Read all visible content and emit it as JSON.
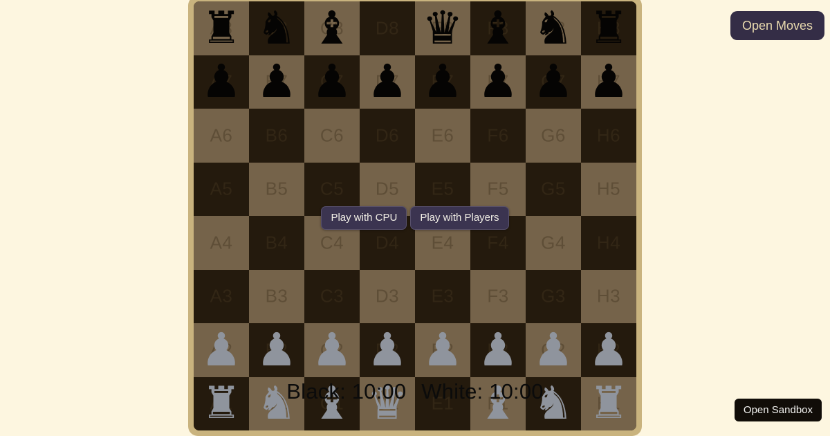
{
  "page": {
    "background_color": "#fdf6e0"
  },
  "board": {
    "border_color": "#c9b37e",
    "light_square_color": "#75634a",
    "dark_square_color": "#241a0d",
    "files": [
      "A",
      "B",
      "C",
      "D",
      "E",
      "F",
      "G",
      "H"
    ],
    "ranks": [
      "8",
      "7",
      "6",
      "5",
      "4",
      "3",
      "2",
      "1"
    ],
    "squares": [
      [
        {
          "label": "A8",
          "shade": "light",
          "piece": "rook",
          "color": "black",
          "glyph": "♜"
        },
        {
          "label": "B8",
          "shade": "dark",
          "piece": "knight",
          "color": "black",
          "glyph": "♞"
        },
        {
          "label": "C8",
          "shade": "light",
          "piece": "bishop",
          "color": "black",
          "glyph": "♝"
        },
        {
          "label": "D8",
          "shade": "dark",
          "piece": null,
          "color": null,
          "glyph": ""
        },
        {
          "label": "E8",
          "shade": "light",
          "piece": "queen",
          "color": "black",
          "glyph": "♛"
        },
        {
          "label": "F8",
          "shade": "dark",
          "piece": "bishop",
          "color": "black",
          "glyph": "♝"
        },
        {
          "label": "G8",
          "shade": "light",
          "piece": "knight",
          "color": "black",
          "glyph": "♞"
        },
        {
          "label": "H8",
          "shade": "dark",
          "piece": "rook",
          "color": "black",
          "glyph": "♜"
        }
      ],
      [
        {
          "label": "A7",
          "shade": "dark",
          "piece": "pawn",
          "color": "black",
          "glyph": "♟"
        },
        {
          "label": "B7",
          "shade": "light",
          "piece": "pawn",
          "color": "black",
          "glyph": "♟"
        },
        {
          "label": "C7",
          "shade": "dark",
          "piece": "pawn",
          "color": "black",
          "glyph": "♟"
        },
        {
          "label": "D7",
          "shade": "light",
          "piece": "pawn",
          "color": "black",
          "glyph": "♟"
        },
        {
          "label": "E7",
          "shade": "dark",
          "piece": "pawn",
          "color": "black",
          "glyph": "♟"
        },
        {
          "label": "F7",
          "shade": "light",
          "piece": "pawn",
          "color": "black",
          "glyph": "♟"
        },
        {
          "label": "G7",
          "shade": "dark",
          "piece": "pawn",
          "color": "black",
          "glyph": "♟"
        },
        {
          "label": "H7",
          "shade": "light",
          "piece": "pawn",
          "color": "black",
          "glyph": "♟"
        }
      ],
      [
        {
          "label": "A6",
          "shade": "light",
          "piece": null,
          "color": null,
          "glyph": ""
        },
        {
          "label": "B6",
          "shade": "dark",
          "piece": null,
          "color": null,
          "glyph": ""
        },
        {
          "label": "C6",
          "shade": "light",
          "piece": null,
          "color": null,
          "glyph": ""
        },
        {
          "label": "D6",
          "shade": "dark",
          "piece": null,
          "color": null,
          "glyph": ""
        },
        {
          "label": "E6",
          "shade": "light",
          "piece": null,
          "color": null,
          "glyph": ""
        },
        {
          "label": "F6",
          "shade": "dark",
          "piece": null,
          "color": null,
          "glyph": ""
        },
        {
          "label": "G6",
          "shade": "light",
          "piece": null,
          "color": null,
          "glyph": ""
        },
        {
          "label": "H6",
          "shade": "dark",
          "piece": null,
          "color": null,
          "glyph": ""
        }
      ],
      [
        {
          "label": "A5",
          "shade": "dark",
          "piece": null,
          "color": null,
          "glyph": ""
        },
        {
          "label": "B5",
          "shade": "light",
          "piece": null,
          "color": null,
          "glyph": ""
        },
        {
          "label": "C5",
          "shade": "dark",
          "piece": null,
          "color": null,
          "glyph": ""
        },
        {
          "label": "D5",
          "shade": "light",
          "piece": null,
          "color": null,
          "glyph": ""
        },
        {
          "label": "E5",
          "shade": "dark",
          "piece": null,
          "color": null,
          "glyph": ""
        },
        {
          "label": "F5",
          "shade": "light",
          "piece": null,
          "color": null,
          "glyph": ""
        },
        {
          "label": "G5",
          "shade": "dark",
          "piece": null,
          "color": null,
          "glyph": ""
        },
        {
          "label": "H5",
          "shade": "light",
          "piece": null,
          "color": null,
          "glyph": ""
        }
      ],
      [
        {
          "label": "A4",
          "shade": "light",
          "piece": null,
          "color": null,
          "glyph": ""
        },
        {
          "label": "B4",
          "shade": "dark",
          "piece": null,
          "color": null,
          "glyph": ""
        },
        {
          "label": "C4",
          "shade": "light",
          "piece": null,
          "color": null,
          "glyph": ""
        },
        {
          "label": "D4",
          "shade": "dark",
          "piece": null,
          "color": null,
          "glyph": ""
        },
        {
          "label": "E4",
          "shade": "light",
          "piece": null,
          "color": null,
          "glyph": ""
        },
        {
          "label": "F4",
          "shade": "dark",
          "piece": null,
          "color": null,
          "glyph": ""
        },
        {
          "label": "G4",
          "shade": "light",
          "piece": null,
          "color": null,
          "glyph": ""
        },
        {
          "label": "H4",
          "shade": "dark",
          "piece": null,
          "color": null,
          "glyph": ""
        }
      ],
      [
        {
          "label": "A3",
          "shade": "dark",
          "piece": null,
          "color": null,
          "glyph": ""
        },
        {
          "label": "B3",
          "shade": "light",
          "piece": null,
          "color": null,
          "glyph": ""
        },
        {
          "label": "C3",
          "shade": "dark",
          "piece": null,
          "color": null,
          "glyph": ""
        },
        {
          "label": "D3",
          "shade": "light",
          "piece": null,
          "color": null,
          "glyph": ""
        },
        {
          "label": "E3",
          "shade": "dark",
          "piece": null,
          "color": null,
          "glyph": ""
        },
        {
          "label": "F3",
          "shade": "light",
          "piece": null,
          "color": null,
          "glyph": ""
        },
        {
          "label": "G3",
          "shade": "dark",
          "piece": null,
          "color": null,
          "glyph": ""
        },
        {
          "label": "H3",
          "shade": "light",
          "piece": null,
          "color": null,
          "glyph": ""
        }
      ],
      [
        {
          "label": "A2",
          "shade": "light",
          "piece": "pawn",
          "color": "white",
          "glyph": "♟"
        },
        {
          "label": "B2",
          "shade": "dark",
          "piece": "pawn",
          "color": "white",
          "glyph": "♟"
        },
        {
          "label": "C2",
          "shade": "light",
          "piece": "pawn",
          "color": "white",
          "glyph": "♟"
        },
        {
          "label": "D2",
          "shade": "dark",
          "piece": "pawn",
          "color": "white",
          "glyph": "♟"
        },
        {
          "label": "E2",
          "shade": "light",
          "piece": "pawn",
          "color": "white",
          "glyph": "♟"
        },
        {
          "label": "F2",
          "shade": "dark",
          "piece": "pawn",
          "color": "white",
          "glyph": "♟"
        },
        {
          "label": "G2",
          "shade": "light",
          "piece": "pawn",
          "color": "white",
          "glyph": "♟"
        },
        {
          "label": "H2",
          "shade": "dark",
          "piece": "pawn",
          "color": "white",
          "glyph": "♟"
        }
      ],
      [
        {
          "label": "A1",
          "shade": "dark",
          "piece": "rook",
          "color": "white",
          "glyph": "♜"
        },
        {
          "label": "B1",
          "shade": "light",
          "piece": "knight",
          "color": "white",
          "glyph": "♞"
        },
        {
          "label": "C1",
          "shade": "dark",
          "piece": "bishop",
          "color": "white",
          "glyph": "♝"
        },
        {
          "label": "D1",
          "shade": "light",
          "piece": "queen",
          "color": "white",
          "glyph": "♛"
        },
        {
          "label": "E1",
          "shade": "dark",
          "piece": null,
          "color": null,
          "glyph": ""
        },
        {
          "label": "F1",
          "shade": "light",
          "piece": "bishop",
          "color": "white",
          "glyph": "♝"
        },
        {
          "label": "G1",
          "shade": "dark",
          "piece": "knight",
          "color": "white",
          "glyph": "♞"
        },
        {
          "label": "H1",
          "shade": "light",
          "piece": "rook",
          "color": "white",
          "glyph": "♜"
        }
      ]
    ]
  },
  "clocks": {
    "black_label": "Black: 10:00",
    "white_label": "White: 10:00"
  },
  "mode_buttons": {
    "play_with_cpu": "Play with CPU",
    "play_with_players": "Play with Players",
    "background_color": "#3b3450",
    "text_color": "#f2efe6"
  },
  "side_buttons": {
    "open_moves": "Open Moves",
    "open_moves_background": "#342d46",
    "open_moves_text_color": "#e8d9ae",
    "open_sandbox": "Open Sandbox",
    "open_sandbox_background": "#110d08",
    "open_sandbox_text_color": "#f4f4f2"
  }
}
